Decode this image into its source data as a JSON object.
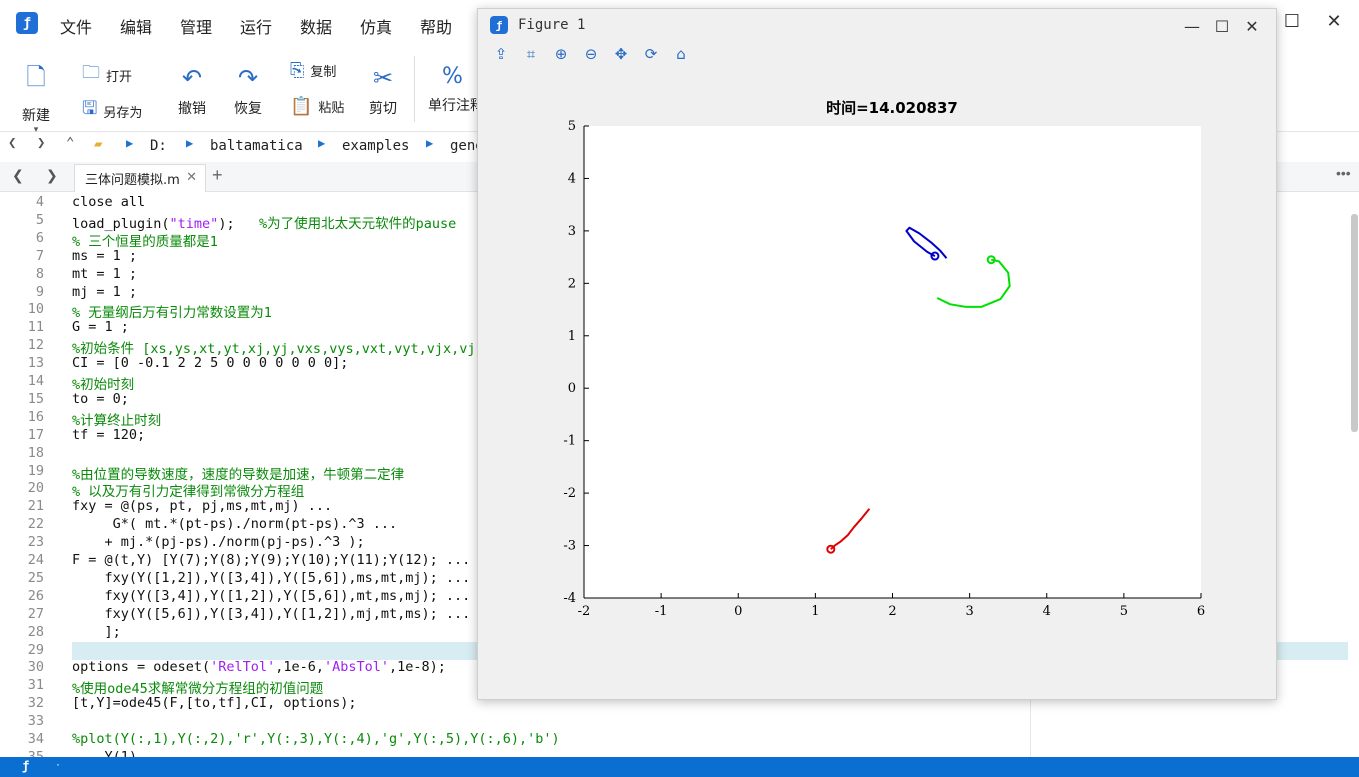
{
  "menubar": {
    "items": [
      "文件",
      "编辑",
      "管理",
      "运行",
      "数据",
      "仿真",
      "帮助"
    ],
    "logo_text": "ƒ",
    "min_icon": "minimize-icon",
    "max_icon": "maximize-icon",
    "close_icon": "close-icon"
  },
  "ribbon": {
    "new_label": "新建",
    "open_label": "打开",
    "saveas_label": "另存为",
    "undo_label": "撤销",
    "redo_label": "恢复",
    "copy_label": "复制",
    "paste_label": "粘贴",
    "cut_label": "剪切",
    "comment_label": "单行注释"
  },
  "address": {
    "segments": [
      "D:",
      "baltamatica",
      "examples",
      "gene"
    ]
  },
  "tabs": [
    {
      "label": "三体问题模拟.m"
    }
  ],
  "editor": {
    "lines": [
      {
        "n": "4",
        "t": "close all",
        "c": ""
      },
      {
        "n": "5",
        "t": "load_plugin(\"time\");   %为了使用北太天元软件的pause",
        "c": "mix5"
      },
      {
        "n": "6",
        "t": "% 三个恒星的质量都是1",
        "c": "cm"
      },
      {
        "n": "7",
        "t": "ms = 1 ;",
        "c": ""
      },
      {
        "n": "8",
        "t": "mt = 1 ;",
        "c": ""
      },
      {
        "n": "9",
        "t": "mj = 1 ;",
        "c": ""
      },
      {
        "n": "10",
        "t": "% 无量纲后万有引力常数设置为1",
        "c": "cm"
      },
      {
        "n": "11",
        "t": "G = 1 ;",
        "c": ""
      },
      {
        "n": "12",
        "t": "%初始条件 [xs,ys,xt,yt,xj,yj,vxs,vys,vxt,vyt,vjx,vj",
        "c": "cm"
      },
      {
        "n": "13",
        "t": "CI = [0 -0.1 2 2 5 0 0 0 0 0 0 0];",
        "c": ""
      },
      {
        "n": "14",
        "t": "%初始时刻",
        "c": "cm"
      },
      {
        "n": "15",
        "t": "to = 0;",
        "c": ""
      },
      {
        "n": "16",
        "t": "%计算终止时刻",
        "c": "cm"
      },
      {
        "n": "17",
        "t": "tf = 120;",
        "c": ""
      },
      {
        "n": "18",
        "t": "",
        "c": ""
      },
      {
        "n": "19",
        "t": "%由位置的导数速度，速度的导数是加速，牛顿第二定律",
        "c": "cm"
      },
      {
        "n": "20",
        "t": "% 以及万有引力定律得到常微分方程组",
        "c": "cm"
      },
      {
        "n": "21",
        "t": "fxy = @(ps, pt, pj,ms,mt,mj) ...",
        "c": ""
      },
      {
        "n": "22",
        "t": "     G*( mt.*(pt-ps)./norm(pt-ps).^3 ...",
        "c": ""
      },
      {
        "n": "23",
        "t": "    + mj.*(pj-ps)./norm(pj-ps).^3 );",
        "c": ""
      },
      {
        "n": "24",
        "t": "F = @(t,Y) [Y(7);Y(8);Y(9);Y(10);Y(11);Y(12); ...",
        "c": ""
      },
      {
        "n": "25",
        "t": "    fxy(Y([1,2]),Y([3,4]),Y([5,6]),ms,mt,mj); ...",
        "c": ""
      },
      {
        "n": "26",
        "t": "    fxy(Y([3,4]),Y([1,2]),Y([5,6]),mt,ms,mj); ...",
        "c": ""
      },
      {
        "n": "27",
        "t": "    fxy(Y([5,6]),Y([3,4]),Y([1,2]),mj,mt,ms); ...",
        "c": ""
      },
      {
        "n": "28",
        "t": "    ];",
        "c": ""
      },
      {
        "n": "29",
        "t": "",
        "c": ""
      },
      {
        "n": "30",
        "t": "options = odeset('RelTol',1e-6,'AbsTol',1e-8);",
        "c": "mix30"
      },
      {
        "n": "31",
        "t": "%使用ode45求解常微分方程组的初值问题",
        "c": "cm"
      },
      {
        "n": "32",
        "t": "[t,Y]=ode45(F,[to,tf],CI, options);",
        "c": ""
      },
      {
        "n": "33",
        "t": "",
        "c": ""
      },
      {
        "n": "34",
        "t": "%plot(Y(:,1),Y(:,2),'r',Y(:,3),Y(:,4),'g',Y(:,5),Y(:,6),'b')",
        "c": "cm"
      },
      {
        "n": "35",
        "t": "    Y(1)",
        "c": ""
      }
    ]
  },
  "figure": {
    "title": "Figure 1",
    "toolbar_icons": [
      "save-icon",
      "zoom-box-icon",
      "zoom-in-icon",
      "zoom-out-icon",
      "pan-icon",
      "rotate-icon",
      "home-icon"
    ]
  },
  "chart_data": {
    "type": "line",
    "title": "时间=14.020837",
    "xlabel": "",
    "ylabel": "",
    "xlim": [
      -2,
      6
    ],
    "ylim": [
      -4,
      5
    ],
    "xticks": [
      -2,
      -1,
      0,
      1,
      2,
      3,
      4,
      5,
      6
    ],
    "yticks": [
      -4,
      -3,
      -2,
      -1,
      0,
      1,
      2,
      3,
      4,
      5
    ],
    "grid": false,
    "series": [
      {
        "color": "#e00000",
        "marker_end": true,
        "x": [
          1.7,
          1.6,
          1.5,
          1.42,
          1.33,
          1.25,
          1.2
        ],
        "y": [
          -2.3,
          -2.48,
          -2.65,
          -2.8,
          -2.92,
          -3.0,
          -3.07
        ]
      },
      {
        "color": "#00e000",
        "marker_end": true,
        "x": [
          2.58,
          2.75,
          2.95,
          3.15,
          3.4,
          3.52,
          3.5,
          3.38,
          3.28
        ],
        "y": [
          1.72,
          1.6,
          1.55,
          1.55,
          1.7,
          1.95,
          2.2,
          2.42,
          2.45
        ]
      },
      {
        "color": "#0000cc",
        "marker_end": true,
        "x": [
          2.7,
          2.62,
          2.5,
          2.35,
          2.22,
          2.18,
          2.28,
          2.45,
          2.55
        ],
        "y": [
          2.48,
          2.62,
          2.78,
          2.95,
          3.06,
          3.0,
          2.8,
          2.6,
          2.52
        ]
      }
    ]
  }
}
